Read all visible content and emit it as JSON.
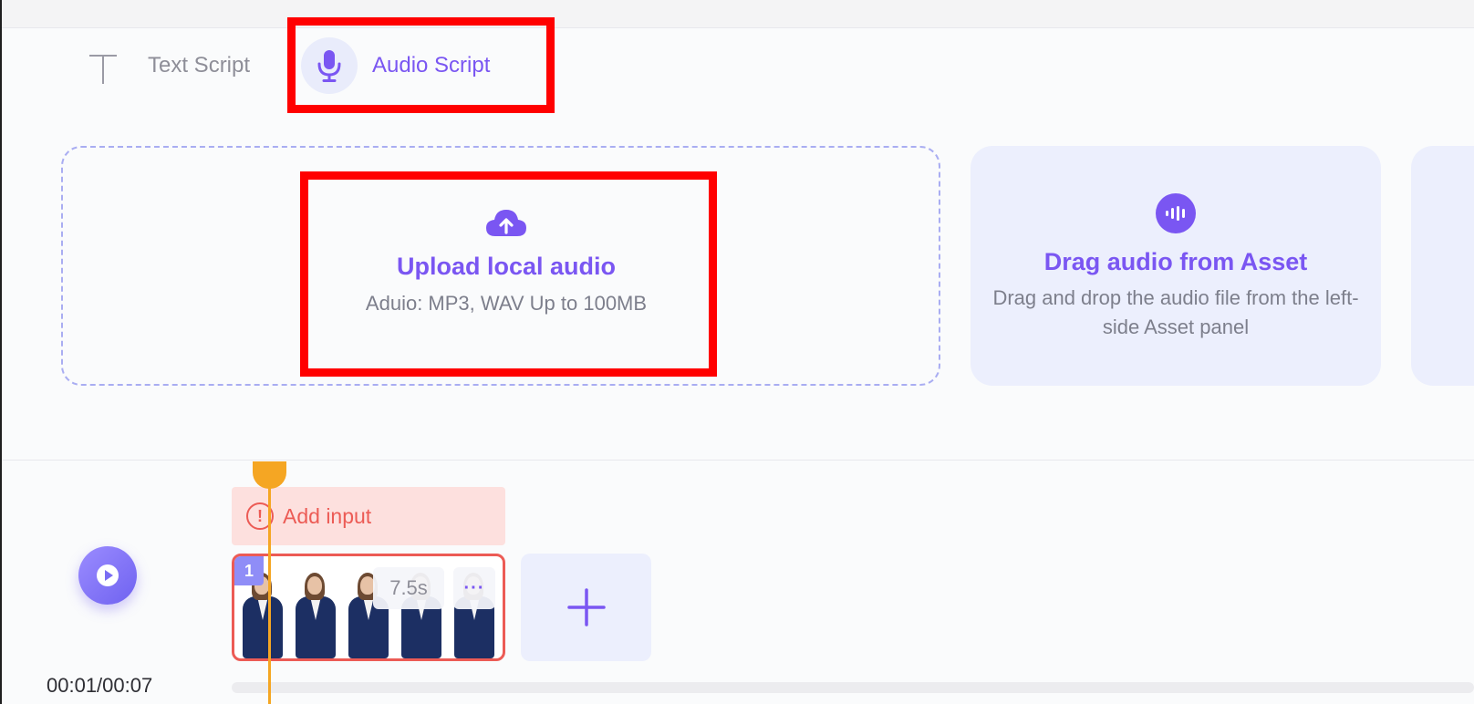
{
  "tabs": {
    "text_script": {
      "label": "Text Script",
      "icon": "text-t-icon"
    },
    "audio_script": {
      "label": "Audio Script",
      "icon": "microphone-icon",
      "active": true
    }
  },
  "upload": {
    "icon": "cloud-upload-icon",
    "title": "Upload local audio",
    "subtitle": "Aduio: MP3, WAV Up to 100MB"
  },
  "asset_card": {
    "icon": "audio-wave-icon",
    "title": "Drag audio from Asset",
    "description": "Drag and drop the audio file from the left-side Asset panel"
  },
  "timeline": {
    "time_display": "00:01/00:07",
    "add_input_label": "Add input",
    "clip": {
      "index": "1",
      "duration": "7.5s",
      "more_label": "···"
    }
  },
  "colors": {
    "accent": "#7a56f2",
    "warning": "#ec5b55",
    "playhead": "#f5a623",
    "highlight": "#ff0000"
  }
}
